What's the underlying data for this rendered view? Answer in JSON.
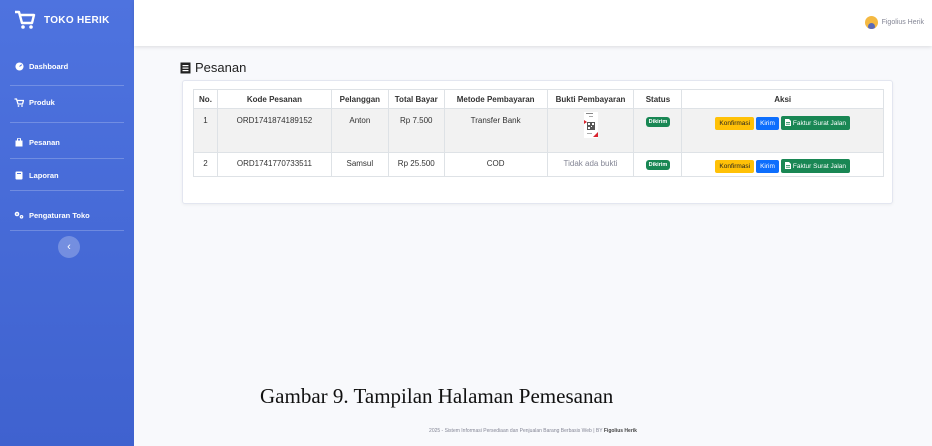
{
  "brand": {
    "name": "TOKO HERIK"
  },
  "sidebar": {
    "items": [
      {
        "label": "Dashboard",
        "icon": "dashboard-icon"
      },
      {
        "label": "Produk",
        "icon": "cart-icon"
      },
      {
        "label": "Pesanan",
        "icon": "bag-icon"
      },
      {
        "label": "Laporan",
        "icon": "book-icon"
      },
      {
        "label": "Pengaturan Toko",
        "icon": "gears-icon"
      }
    ],
    "toggle_label": "‹"
  },
  "topbar": {
    "user_name": "Figolius Herik"
  },
  "page": {
    "title": "Pesanan"
  },
  "table": {
    "headers": [
      "No.",
      "Kode Pesanan",
      "Pelanggan",
      "Total Bayar",
      "Metode Pembayaran",
      "Bukti Pembayaran",
      "Status",
      "Aksi"
    ],
    "rows": [
      {
        "no": "1",
        "kode": "ORD1741874189152",
        "pelanggan": "Anton",
        "total": "Rp 7.500",
        "metode": "Transfer Bank",
        "bukti": "",
        "status": "Dikirim"
      },
      {
        "no": "2",
        "kode": "ORD1741770733511",
        "pelanggan": "Samsul",
        "total": "Rp 25.500",
        "metode": "COD",
        "bukti": "Tidak ada bukti",
        "status": "Dikirim"
      }
    ],
    "actions": {
      "confirm": "Konfirmasi",
      "send": "Kirim",
      "invoice": "Faktur Surat Jalan"
    }
  },
  "caption": "Gambar 9. Tampilan Halaman Pemesanan",
  "footer": {
    "text": "2025 - Sistem Informasi Persediaan dan Penjualan Barang Berbasis Web | BY ",
    "author": "Figolius Herik"
  },
  "colors": {
    "sidebar": "#4e73df",
    "success": "#198754",
    "primary": "#0d6efd",
    "warning": "#ffc107"
  }
}
